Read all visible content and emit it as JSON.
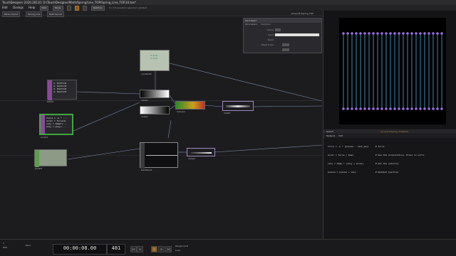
{
  "window": {
    "title": "TouchDesigner 2020.28110: D:/TouchDesigner/Math/Spring/Line_TOP/Spring_Line_TOP.16.toe*"
  },
  "menu": {
    "items": [
      "Edit",
      "Dialogs",
      "Help"
    ],
    "tool_boxes": [
      "Nets",
      "Panes",
      "",
      "",
      ""
    ],
    "right_status": "Realtime",
    "right_info": "8 x 16 operators selected, updated"
  },
  "tabs": {
    "tabs": [
      "Panel Layout",
      "Spring_Line",
      "Split Layout"
    ],
    "path": "/project1/Spring_TOP"
  },
  "network": {
    "nodes": [
      {
        "id": "constant1",
        "name": "constant1",
        "text": "0.0(0)\n0.0(0)"
      },
      {
        "id": "table1",
        "name": "table1",
        "text": "1. NxCtl=0\n2. NxCtl=0\n3. NxCtl=0\n4. NxCtl=0"
      },
      {
        "id": "script1",
        "name": "script1",
        "text": "force = -k * ...\naccel = force/m\nvely = damp*(...\nposy = posy+..."
      },
      {
        "id": "ramp1",
        "name": "ramp1"
      },
      {
        "id": "noise1",
        "name": "noise1"
      },
      {
        "id": "lookup1",
        "name": "lookup1"
      },
      {
        "id": "math1",
        "name": "math1"
      },
      {
        "id": "feedback1",
        "name": "feedback1"
      },
      {
        "id": "ramp2",
        "name": "ramp2"
      },
      {
        "id": "null1",
        "name": "null1"
      },
      {
        "id": "panel1",
        "name": "panel1"
      }
    ]
  },
  "param_panel": {
    "title": "feed  feed1",
    "tabs": [
      "Parameters",
      "Common"
    ],
    "rows": [
      "Active",
      "Input",
      "",
      "Reset",
      "Reset Pulse"
    ]
  },
  "viewer": {
    "line_color": "#4ab0e0",
    "dot_color": "#9b6fe0",
    "line_count": 24
  },
  "textport": {
    "header": "Search",
    "tabs": [
      "Textport",
      "DAT"
    ],
    "path": "/project1/Spring_TOP/feed",
    "code_lines": [
      "force = -k * (posnow - rest_pos)     # force",
      "accel = force / mass                 # See the acceleration, Press on unfix",
      "vely = damp * (vely + accel)         # Get the velocity",
      "posnow = posnow + vely               # Updated position"
    ]
  },
  "timeline": {
    "timecode": "00:00:08.00",
    "frame": "481",
    "start": "1",
    "end": "600",
    "fps": "60.0",
    "range_label": "Range Limit",
    "play_label": "Loop",
    "buttons": [
      "|<",
      "<",
      "[]",
      ">",
      ">|"
    ]
  }
}
